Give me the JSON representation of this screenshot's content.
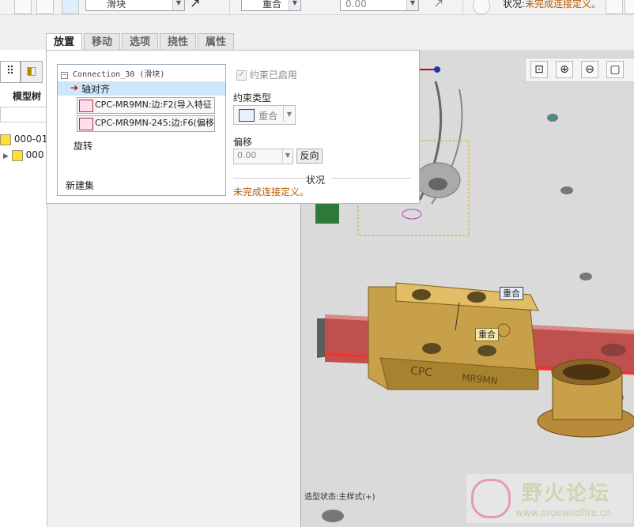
{
  "toolbar": {
    "component_type": "滑块",
    "constraint_type": "重合",
    "offset_value": "0.00",
    "status_label": "状况:",
    "status_text": "未完成连接定义。"
  },
  "tabs": [
    {
      "label": "放置",
      "active": true
    },
    {
      "label": "移动",
      "active": false
    },
    {
      "label": "选项",
      "active": false
    },
    {
      "label": "挠性",
      "active": false
    },
    {
      "label": "属性",
      "active": false
    }
  ],
  "placement": {
    "connection_name": "Connection_30 (滑块)",
    "axis_align": "轴对齐",
    "refs": [
      "CPC-MR9MN:边:F2(导入特征",
      "CPC-MR9MN-245:边:F6(偏移"
    ],
    "rotation": "旋转",
    "new_set": "新建集",
    "constraint_enabled": "约束已启用",
    "constraint_type_label": "约束类型",
    "constraint_type_value": "重合",
    "offset_label": "偏移",
    "offset_value": "0.00",
    "flip_button": "反向",
    "status_title": "状况",
    "status_text": "未完成连接定义。"
  },
  "tree": {
    "title": "模型树",
    "items": [
      "000-01",
      "000"
    ]
  },
  "viewport": {
    "tag_top": "重合",
    "tag_mid": "重合",
    "rail_text_1": "CPC",
    "rail_text_2": "MR9MN",
    "model_state": "造型状态:主样式(+)"
  },
  "watermark": {
    "name": "野火论坛",
    "url": "www.proewildfire.cn"
  },
  "colors": {
    "status": "#b55a00",
    "highlight_row": "#cde6fb",
    "rail": "#c0504d",
    "block": "#c9a04a"
  }
}
